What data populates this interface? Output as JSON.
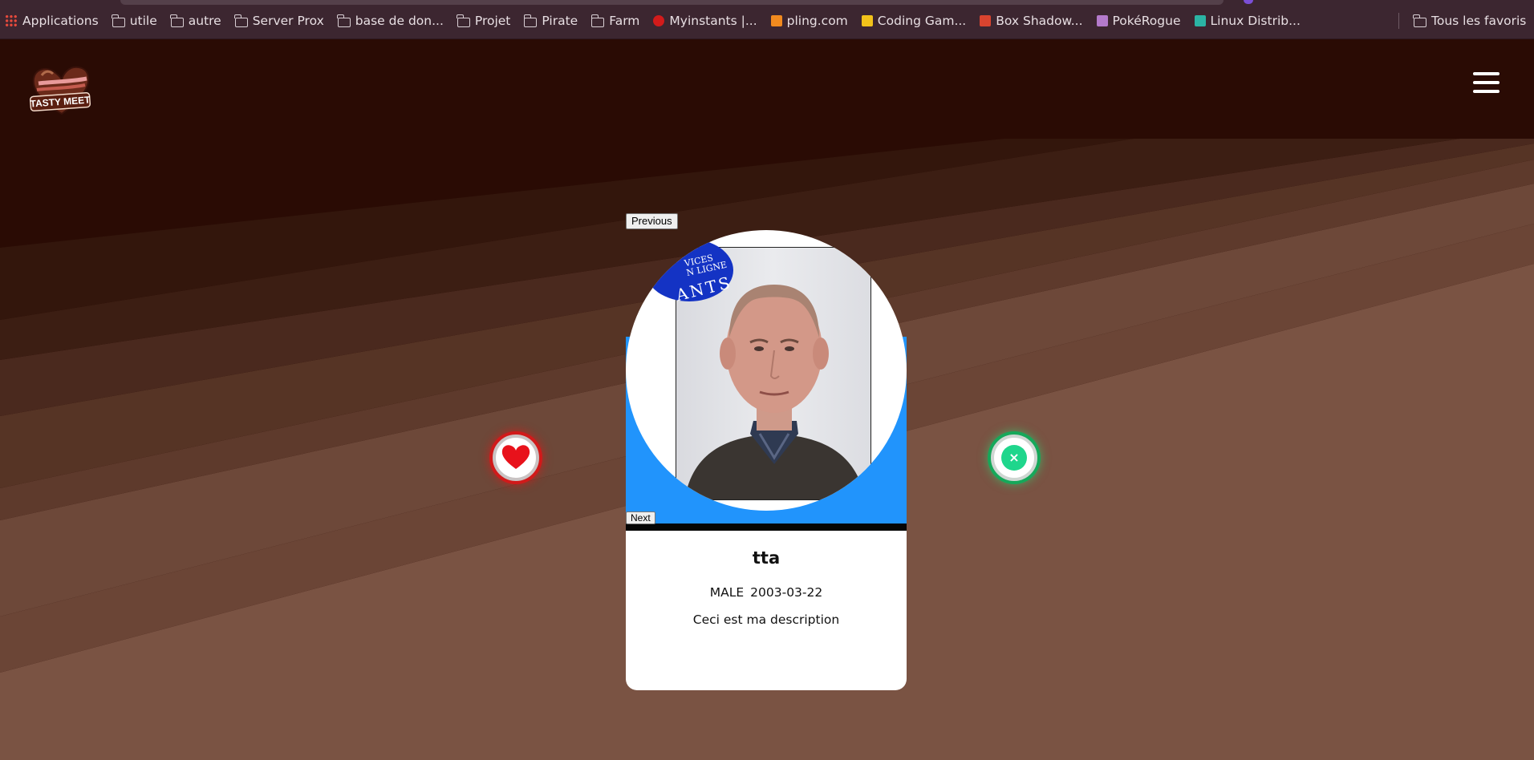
{
  "bookmarks": [
    {
      "label": "Applications",
      "icon": "apps-grid-icon"
    },
    {
      "label": "utile",
      "icon": "folder-icon"
    },
    {
      "label": "autre",
      "icon": "folder-icon"
    },
    {
      "label": "Server Prox",
      "icon": "folder-icon"
    },
    {
      "label": "base de don...",
      "icon": "folder-icon"
    },
    {
      "label": "Projet",
      "icon": "folder-icon"
    },
    {
      "label": "Pirate",
      "icon": "folder-icon"
    },
    {
      "label": "Farm",
      "icon": "folder-icon"
    },
    {
      "label": "Myinstants |...",
      "icon": "myinstants-favicon"
    },
    {
      "label": "pling.com",
      "icon": "pling-favicon"
    },
    {
      "label": "Coding Gam...",
      "icon": "codingame-favicon"
    },
    {
      "label": "Box Shadow...",
      "icon": "box-shadow-favicon"
    },
    {
      "label": "PokéRogue",
      "icon": "pokerogue-favicon"
    },
    {
      "label": "Linux Distrib...",
      "icon": "linux-distrib-favicon"
    }
  ],
  "all_bookmarks": {
    "label": "Tous les favoris",
    "icon": "folder-icon"
  },
  "app": {
    "logo_text": "TASTY MEET",
    "menu_icon": "hamburger-menu-icon"
  },
  "carousel": {
    "previous_label": "Previous",
    "next_label": "Next",
    "stamp_small": "VICES\nN LIGNE",
    "stamp_big": "ANTS"
  },
  "profile": {
    "name": "tta",
    "gender": "MALE",
    "birthdate": "2003-03-22",
    "description": "Ceci est ma description"
  },
  "actions": {
    "like_icon": "heart-icon",
    "dislike_icon": "close-icon",
    "dislike_glyph": "×"
  },
  "colors": {
    "card_accent": "#2194fc",
    "like": "#e8121b",
    "dislike": "#1fd68c",
    "background": "#2a0b04"
  }
}
